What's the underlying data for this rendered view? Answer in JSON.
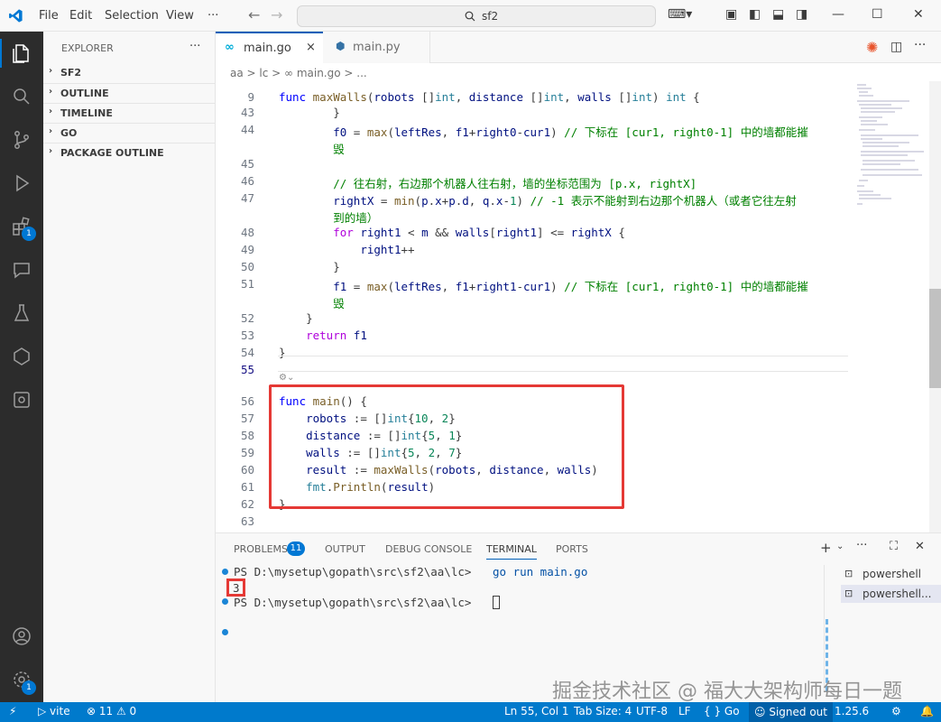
{
  "menu": {
    "file": "File",
    "edit": "Edit",
    "selection": "Selection",
    "view": "View",
    "more": "···"
  },
  "search": {
    "text": "sf2"
  },
  "explorer": {
    "header": "EXPLORER",
    "more": "···",
    "sections": [
      "SF2",
      "OUTLINE",
      "TIMELINE",
      "GO",
      "PACKAGE OUTLINE"
    ]
  },
  "activity": {
    "extensions_badge": "1",
    "settings_badge": "1"
  },
  "tabs": [
    {
      "label": "main.go",
      "close": "×"
    },
    {
      "label": "main.py"
    }
  ],
  "breadcrumb": {
    "text": "aa > lc > ∞ main.go > ..."
  },
  "editor": {
    "lines": [
      {
        "n": "9",
        "html": "<span class=\"kw\">func</span> <span class=\"fn\">maxWalls</span>(<span class=\"var\">robots</span> []<span class=\"ty\">int</span>, <span class=\"var\">distance</span> []<span class=\"ty\">int</span>, <span class=\"var\">walls</span> []<span class=\"ty\">int</span>) <span class=\"ty\">int</span> {"
      },
      {
        "n": "43",
        "html": "        }"
      },
      {
        "n": "44",
        "html": "        <span class=\"var\">f0</span> = <span class=\"fn\">max</span>(<span class=\"var\">leftRes</span>, <span class=\"var\">f1</span>+<span class=\"var\">right0</span>-<span class=\"var\">cur1</span>) <span class=\"cm\">// 下标在 [cur1, right0-1] 中的墙都能摧</span>"
      },
      {
        "n": "",
        "html": "        <span class=\"cm\">毁</span>"
      },
      {
        "n": "45",
        "html": ""
      },
      {
        "n": "46",
        "html": "        <span class=\"cm\">// 往右射，右边那个机器人往右射，墙的坐标范围为 [p.x, rightX]</span>"
      },
      {
        "n": "47",
        "html": "        <span class=\"var\">rightX</span> = <span class=\"fn\">min</span>(<span class=\"var\">p</span>.<span class=\"var\">x</span>+<span class=\"var\">p</span>.<span class=\"var\">d</span>, <span class=\"var\">q</span>.<span class=\"var\">x</span>-<span class=\"num\">1</span>) <span class=\"cm\">// -1 表示不能射到右边那个机器人（或者它往左射</span>"
      },
      {
        "n": "",
        "html": "        <span class=\"cm\">到的墙）</span>"
      },
      {
        "n": "48",
        "html": "        <span class=\"kw2\">for</span> <span class=\"var\">right1</span> &lt; <span class=\"var\">m</span> &amp;&amp; <span class=\"var\">walls</span>[<span class=\"var\">right1</span>] &lt;= <span class=\"var\">rightX</span> {"
      },
      {
        "n": "49",
        "html": "            <span class=\"var\">right1</span>++"
      },
      {
        "n": "50",
        "html": "        }"
      },
      {
        "n": "51",
        "html": "        <span class=\"var\">f1</span> = <span class=\"fn\">max</span>(<span class=\"var\">leftRes</span>, <span class=\"var\">f1</span>+<span class=\"var\">right1</span>-<span class=\"var\">cur1</span>) <span class=\"cm\">// 下标在 [cur1, right0-1] 中的墙都能摧</span>"
      },
      {
        "n": "",
        "html": "        <span class=\"cm\">毁</span>"
      },
      {
        "n": "52",
        "html": "    }"
      },
      {
        "n": "53",
        "html": "    <span class=\"kw2\">return</span> <span class=\"var\">f1</span>"
      },
      {
        "n": "54",
        "html": "}"
      },
      {
        "n": "55",
        "html": ""
      },
      {
        "n": "56",
        "html": "<span class=\"kw\">func</span> <span class=\"fn\">main</span>() {"
      },
      {
        "n": "57",
        "html": "    <span class=\"var\">robots</span> := []<span class=\"ty\">int</span>{<span class=\"num\">10</span>, <span class=\"num\">2</span>}"
      },
      {
        "n": "58",
        "html": "    <span class=\"var\">distance</span> := []<span class=\"ty\">int</span>{<span class=\"num\">5</span>, <span class=\"num\">1</span>}"
      },
      {
        "n": "59",
        "html": "    <span class=\"var\">walls</span> := []<span class=\"ty\">int</span>{<span class=\"num\">5</span>, <span class=\"num\">2</span>, <span class=\"num\">7</span>}"
      },
      {
        "n": "60",
        "html": "    <span class=\"var\">result</span> := <span class=\"fn\">maxWalls</span>(<span class=\"var\">robots</span>, <span class=\"var\">distance</span>, <span class=\"var\">walls</span>)"
      },
      {
        "n": "61",
        "html": "    <span class=\"ty\">fmt</span>.<span class=\"fn\">Println</span>(<span class=\"var\">result</span>)"
      },
      {
        "n": "62",
        "html": "}"
      },
      {
        "n": "63",
        "html": ""
      }
    ]
  },
  "panel": {
    "tabs": [
      "PROBLEMS",
      "OUTPUT",
      "DEBUG CONSOLE",
      "TERMINAL",
      "PORTS"
    ],
    "problems_count": "11",
    "terminal": {
      "line1_prompt": "PS D:\\mysetup\\gopath\\src\\sf2\\aa\\lc>",
      "line1_cmd": "go run main.go",
      "output": "3",
      "line3_prompt": "PS D:\\mysetup\\gopath\\src\\sf2\\aa\\lc>"
    },
    "shells": [
      "powershell",
      "powershell..."
    ]
  },
  "status": {
    "remote": "⚡",
    "vite": "vite",
    "problems": "⊗ 11 ⚠ 0",
    "position": "Ln 55, Col 1",
    "tabsize": "Tab Size: 4",
    "encoding": "UTF-8",
    "eol": "LF",
    "language": "{ } Go",
    "account": "Signed out",
    "version": "1.25.6"
  },
  "watermark": "掘金技术社区 @ 福大大架构师每日一题",
  "colors": {
    "accent": "#0078d4",
    "statusbar": "#007acc",
    "highlight": "#e53935"
  }
}
